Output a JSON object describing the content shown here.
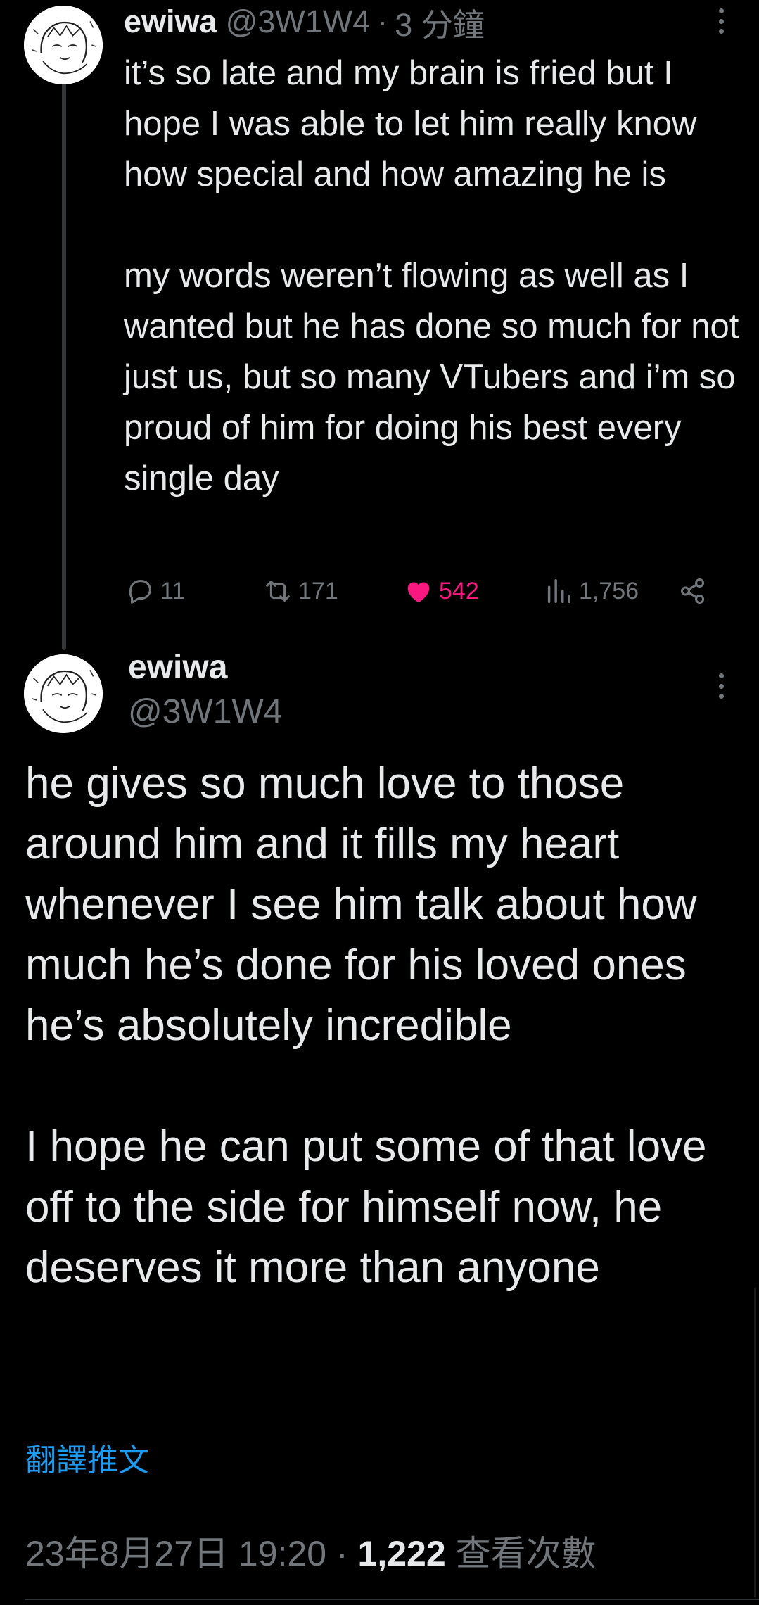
{
  "tweet1": {
    "display_name": "ewiwa",
    "handle": "@3W1W4",
    "separator": "·",
    "time_ago": "3 分鐘",
    "paragraphs": [
      "it’s so late and my brain is fried but I hope I was able to let him really know how special and how amazing he is",
      "my words weren’t flowing as well as I wanted but he has done so much for not just us, but so many VTubers and i’m so proud of him for doing his best every single day"
    ],
    "actions": {
      "replies": "11",
      "retweets": "171",
      "likes": "542",
      "views": "1,756"
    }
  },
  "tweet2": {
    "display_name": "ewiwa",
    "handle": "@3W1W4",
    "paragraphs": [
      "he gives so much love to those around him and it fills my heart whenever I see him talk about how much he’s done for his loved ones\nhe’s absolutely incredible",
      "I hope he can put some of that love off to the side for himself now, he deserves it more than anyone"
    ],
    "translate_label": "翻譯推文",
    "timestamp": "23年8月27日 19:20",
    "separator": "·",
    "view_count": "1,222",
    "view_label": "查看次數"
  },
  "icons": {
    "reply": "reply-icon",
    "retweet": "retweet-icon",
    "like": "heart-icon",
    "views": "views-chart-icon",
    "share": "share-icon",
    "more": "more-options-icon"
  },
  "colors": {
    "background": "#000000",
    "text_primary": "#e7e9ea",
    "text_secondary": "#71767b",
    "like_active": "#f91880",
    "link": "#1d9bf0"
  }
}
